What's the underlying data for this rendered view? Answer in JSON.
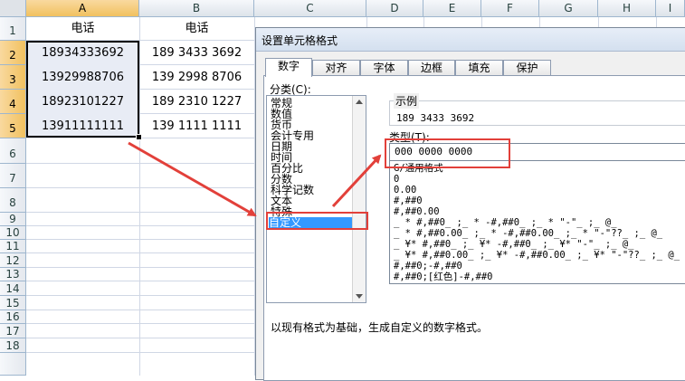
{
  "sheet": {
    "columns": [
      "A",
      "B",
      "C",
      "D",
      "E",
      "F",
      "G",
      "H",
      "I"
    ],
    "rows": [
      "1",
      "2",
      "3",
      "4",
      "5",
      "6",
      "7",
      "8",
      "9",
      "10",
      "11",
      "12",
      "13",
      "14",
      "15",
      "16",
      "17",
      "18"
    ],
    "header_a": "电话",
    "header_b": "电话",
    "col_a_values": [
      "18934333692",
      "13929988706",
      "18923101227",
      "13911111111"
    ],
    "col_b_values": [
      "189 3433 3692",
      "139 2998 8706",
      "189 2310 1227",
      "139 1111 1111"
    ]
  },
  "dialog": {
    "title": "设置单元格格式",
    "tabs": [
      "数字",
      "对齐",
      "字体",
      "边框",
      "填充",
      "保护"
    ],
    "active_tab": "数字",
    "category_label": "分类(C):",
    "categories": [
      "常规",
      "数值",
      "货币",
      "会计专用",
      "日期",
      "时间",
      "百分比",
      "分数",
      "科学记数",
      "文本",
      "特殊",
      "自定义"
    ],
    "selected_category": "自定义",
    "sample_label": "示例",
    "sample_value": "189 3433 3692",
    "type_label": "类型(T):",
    "type_value": "000 0000 0000",
    "formats": [
      "G/通用格式",
      "0",
      "0.00",
      "#,##0",
      "#,##0.00",
      "_ * #,##0_ ;_ * -#,##0_ ;_ * \"-\"_ ;_ @_",
      "_ * #,##0.00_ ;_ * -#,##0.00_ ;_ * \"-\"??_ ;_ @_",
      "_ ¥* #,##0_ ;_ ¥* -#,##0_ ;_ ¥* \"-\"_ ;_ @_",
      "_ ¥* #,##0.00_ ;_ ¥* -#,##0.00_ ;_ ¥* \"-\"??_ ;_ @_",
      "#,##0;-#,##0",
      "#,##0;[红色]-#,##0"
    ],
    "description": "以现有格式为基础，生成自定义的数字格式。"
  },
  "colors": {
    "annotation": "#e2403a",
    "selection": "#3399ff",
    "header_selected": "#f1c15f"
  }
}
